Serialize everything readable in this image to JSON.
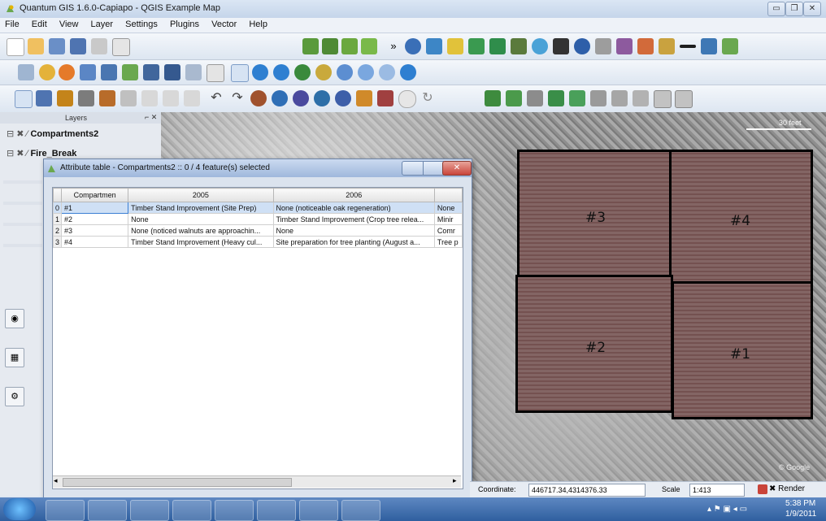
{
  "window": {
    "title": "Quantum GIS 1.6.0-Capiapo - QGIS Example Map",
    "buttons": [
      "▭",
      "❐",
      "✕"
    ]
  },
  "menu": [
    "File",
    "Edit",
    "View",
    "Layer",
    "Settings",
    "Plugins",
    "Vector",
    "Help"
  ],
  "layers_panel": {
    "header": "Layers",
    "header_buttons": "⌐ ✕",
    "items": [
      "Compartments2",
      "Fire_Break"
    ]
  },
  "attribute_table": {
    "title": "Attribute table - Compartments2 :: 0 / 4 feature(s) selected",
    "columns": [
      "Compartmen",
      "2005",
      "2006",
      ""
    ],
    "rows": [
      {
        "index": "0",
        "id": "#1",
        "c2005": "Timber Stand Improvement (Site Prep)",
        "c2006": "None (noticeable oak regeneration)",
        "c2007": "None"
      },
      {
        "index": "1",
        "id": "#2",
        "c2005": "None",
        "c2006": "Timber Stand Improvement (Crop tree relea...",
        "c2007": "Minir"
      },
      {
        "index": "2",
        "id": "#3",
        "c2005": "None (noticed walnuts are approachin...",
        "c2006": "None",
        "c2007": "Comr"
      },
      {
        "index": "3",
        "id": "#4",
        "c2005": "Timber Stand Improvement (Heavy cul...",
        "c2006": "Site preparation for tree planting (August a...",
        "c2007": "Tree p"
      }
    ]
  },
  "map": {
    "labels": [
      "#3",
      "#4",
      "#2",
      "#1"
    ],
    "scalebar": "30 feet",
    "credit": "© Google"
  },
  "status": {
    "coordinate_label": "Coordinate:",
    "coordinate_value": "446717.34,4314376.33",
    "scale_label": "Scale",
    "scale_value": "1:413",
    "render_label": "Render"
  },
  "taskbar": {
    "time": "5:38 PM",
    "date": "1/9/2011"
  },
  "colors": {
    "accent": "#2f5f9f",
    "compartment_fill": "#7c6a68",
    "selected_row": "#cfe0f5"
  }
}
